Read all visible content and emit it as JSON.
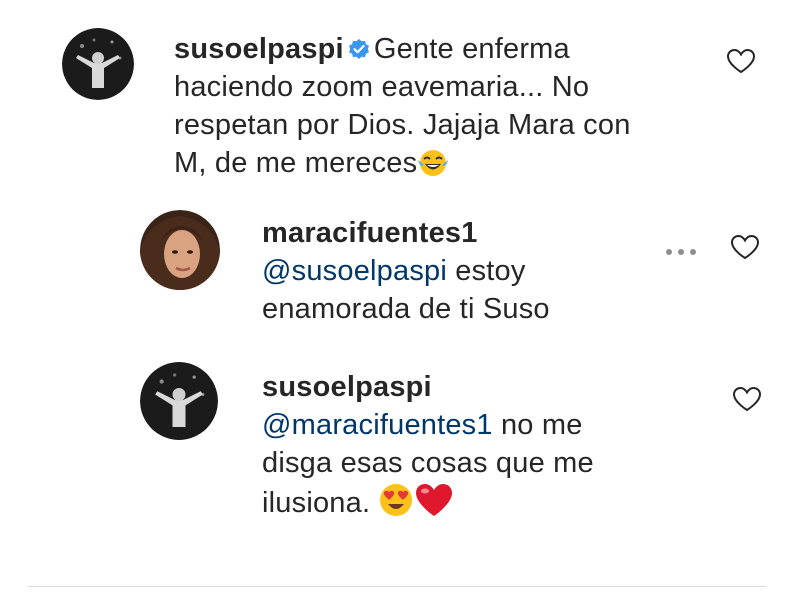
{
  "comments": [
    {
      "username": "susoelpaspi",
      "verified": true,
      "line1": "Gente enferma",
      "line2": "haciendo zoom eavemaria... No",
      "line3": "respetan por Dios. Jajaja Mara con",
      "line4": "M, de me mereces",
      "emoji": "laughing-tears-emoji"
    },
    {
      "username": "maracifuentes1",
      "mention": "@susoelpaspi",
      "line1_rest": " estoy",
      "line2": "enamorada de ti Suso",
      "has_more_menu": true
    },
    {
      "username": "susoelpaspi",
      "mention": "@maracifuentes1",
      "line1_rest": " no me",
      "line2": "disga esas cosas que me",
      "line3": "ilusiona. ",
      "emoji": [
        "heart-eyes-emoji",
        "red-heart-emoji"
      ]
    }
  ],
  "colors": {
    "text": "#262626",
    "mention": "#00376b",
    "verified": "#3897f0",
    "icon": "#262626"
  }
}
